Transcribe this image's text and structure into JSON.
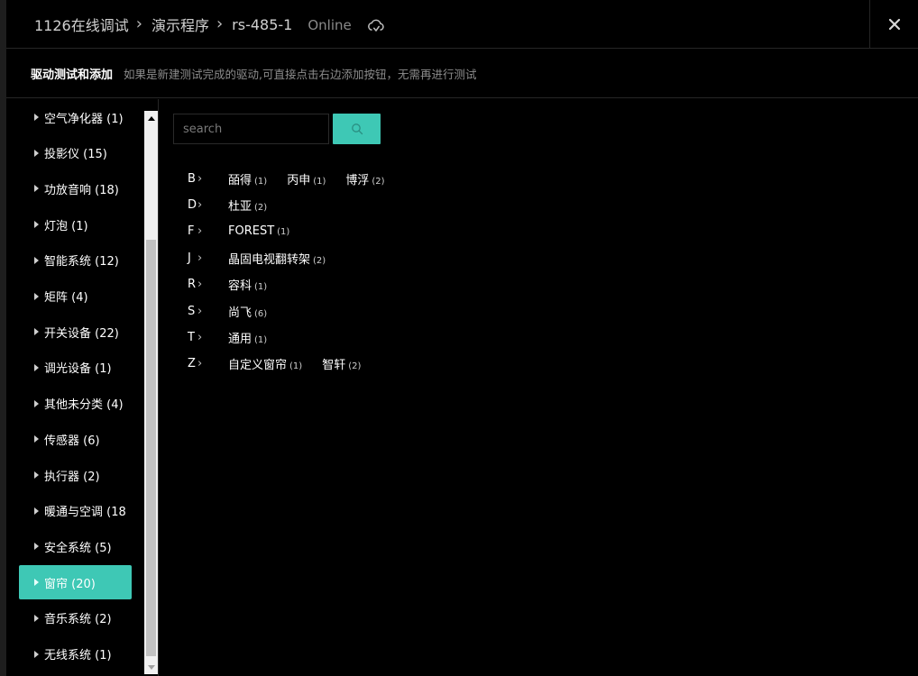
{
  "header": {
    "breadcrumb": [
      "1126在线调试",
      "演示程序",
      "rs-485-1"
    ],
    "status": "Online",
    "status_color": "#8a8a8a",
    "sync_icon": "cloud-sync-icon",
    "close_icon": "close-icon"
  },
  "subheader": {
    "title": "驱动测试和添加",
    "hint": "如果是新建测试完成的驱动,可直接点击右边添加按钮，无需再进行测试"
  },
  "sidebar": {
    "categories": [
      {
        "label": "空气净化器 (1)"
      },
      {
        "label": "投影仪 (15)"
      },
      {
        "label": "功放音响 (18)"
      },
      {
        "label": "灯泡 (1)"
      },
      {
        "label": "智能系统 (12)"
      },
      {
        "label": "矩阵 (4)"
      },
      {
        "label": "开关设备 (22)"
      },
      {
        "label": "调光设备 (1)"
      },
      {
        "label": "其他未分类 (4)"
      },
      {
        "label": "传感器 (6)"
      },
      {
        "label": "执行器 (2)"
      },
      {
        "label": "暖通与空调 (18"
      },
      {
        "label": "安全系统 (5)"
      },
      {
        "label": "窗帘 (20)",
        "active": true
      },
      {
        "label": "音乐系统 (2)"
      },
      {
        "label": "无线系统 (1)"
      }
    ],
    "active_color": "#3ec8b5"
  },
  "search": {
    "placeholder": "search",
    "value": "",
    "button_icon": "search-icon",
    "button_color": "#3ec8b5"
  },
  "brands": [
    {
      "letter": "B",
      "items": [
        {
          "name": "皕得",
          "count": "(1)"
        },
        {
          "name": "丙申",
          "count": "(1)"
        },
        {
          "name": "博浮",
          "count": "(2)"
        }
      ]
    },
    {
      "letter": "D",
      "items": [
        {
          "name": "杜亚",
          "count": "(2)"
        }
      ]
    },
    {
      "letter": "F",
      "items": [
        {
          "name": "FOREST",
          "count": "(1)"
        }
      ]
    },
    {
      "letter": "J",
      "items": [
        {
          "name": "晶固电视翻转架",
          "count": "(2)"
        }
      ]
    },
    {
      "letter": "R",
      "items": [
        {
          "name": "容科",
          "count": "(1)"
        }
      ]
    },
    {
      "letter": "S",
      "items": [
        {
          "name": "尚飞",
          "count": "(6)"
        }
      ]
    },
    {
      "letter": "T",
      "items": [
        {
          "name": "通用",
          "count": "(1)"
        }
      ]
    },
    {
      "letter": "Z",
      "items": [
        {
          "name": "自定义窗帘",
          "count": "(1)"
        },
        {
          "name": "智轩",
          "count": "(2)"
        }
      ]
    }
  ]
}
